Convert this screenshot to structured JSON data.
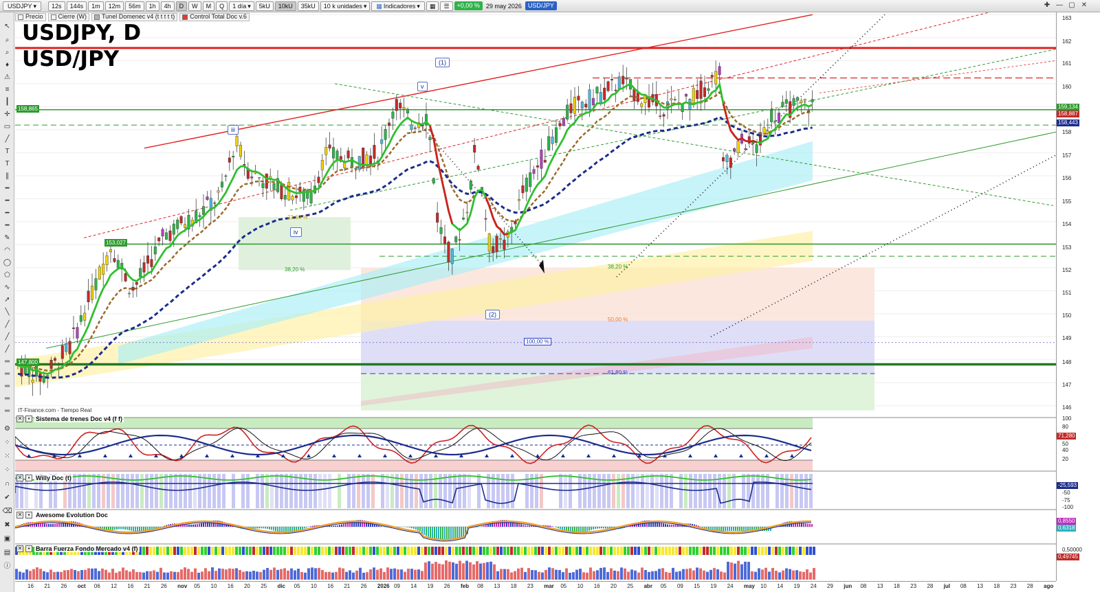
{
  "toolbar": {
    "symbol": "USDJPY",
    "timeframes": [
      "12s",
      "144s",
      "1m",
      "12m",
      "56m",
      "1h",
      "4h",
      "D",
      "W",
      "M",
      "Q"
    ],
    "active_timeframe": "D",
    "period": "1 día",
    "bars_5k": "5kU",
    "bars_10k": "10kU",
    "bars_35k": "35kU",
    "units": "10 k unidades",
    "indicators": "Indicadores",
    "change": "+0,00 %",
    "date": "29 may 2026",
    "pair": "USD/JPY"
  },
  "legend": {
    "items": [
      {
        "label": "Precio",
        "color": "#ffffff"
      },
      {
        "label": "Cierre (W)",
        "color": "#ffffff"
      },
      {
        "label": "Tunel Domenec v4 (t t t t t)",
        "color": "#b0b0b0"
      },
      {
        "label": "Control Total Doc v.6",
        "color": "#e03a3a"
      }
    ]
  },
  "chart": {
    "title_line1": "USDJPY, D",
    "title_line2": "USD/JPY",
    "source": "IT-Finance.com - Tiempo Real",
    "level_tags": {
      "l158": "158,865",
      "l153": "153,027",
      "l147": "147,800"
    },
    "wave_labels": {
      "w1": "(1)",
      "w2": "(2)",
      "wv": "v",
      "wiii": "iii",
      "wiv": "iv"
    },
    "fib_labels": {
      "f236": "23,60 %",
      "f382a": "38,20 %",
      "f382b": "38,20 %",
      "f50": "50,00 %",
      "f100": "100,00 %",
      "f618": "61,80 %"
    }
  },
  "panels": {
    "trenes": "Sistema de trenes Doc v4 (f f)",
    "willy": "Willy Doc (t)",
    "awesome": "Awesome Evolution Doc",
    "barra": "Barra Fuerza Fondo Mercado v4 (f)"
  },
  "price_axis": {
    "labels": [
      "163",
      "162",
      "161",
      "160",
      "158",
      "157",
      "156",
      "155",
      "154",
      "153",
      "152",
      "151",
      "150",
      "149",
      "148",
      "147",
      "146"
    ],
    "tags": {
      "t1": "159,134",
      "t2": "158,887",
      "t3": "158,443"
    },
    "trenes_labels": {
      "a": "100",
      "b": "80",
      "c": "71,280",
      "d": "50",
      "e": "40",
      "f": "20"
    },
    "willy_labels": {
      "a": "-25,593",
      "b": "-50",
      "c": "-75",
      "d": "-100"
    },
    "awesome_labels": {
      "a": "0,8550",
      "b": "0,6318"
    },
    "barra_labels": {
      "a": "0,50000",
      "b": "0,49745"
    }
  },
  "time_axis": {
    "labels": [
      "16",
      "21",
      "26",
      "oct",
      "06",
      "12",
      "16",
      "21",
      "26",
      "nov",
      "05",
      "10",
      "16",
      "20",
      "25",
      "dic",
      "05",
      "10",
      "16",
      "21",
      "26",
      "2026",
      "09",
      "14",
      "19",
      "26",
      "feb",
      "08",
      "13",
      "18",
      "23",
      "mar",
      "05",
      "10",
      "16",
      "20",
      "25",
      "abr",
      "05",
      "09",
      "15",
      "19",
      "24",
      "may",
      "10",
      "14",
      "19",
      "24",
      "29",
      "jun",
      "08",
      "13",
      "18",
      "23",
      "28",
      "jul",
      "08",
      "13",
      "18",
      "23",
      "28",
      "ago"
    ]
  }
}
